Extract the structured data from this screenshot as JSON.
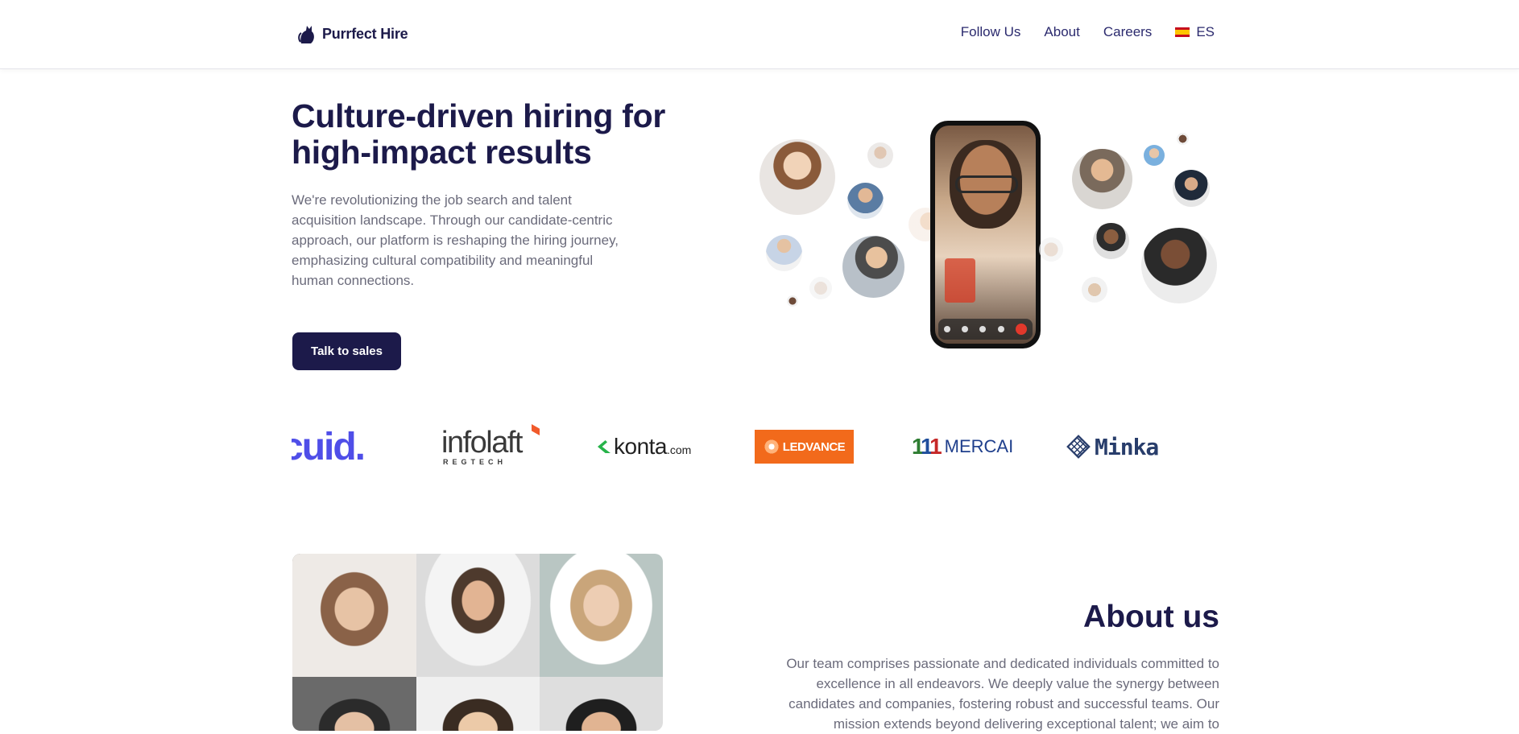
{
  "header": {
    "brand": "Purrfect Hire",
    "nav": [
      {
        "label": "Follow Us"
      },
      {
        "label": "About"
      },
      {
        "label": "Careers"
      }
    ],
    "language": {
      "label": "ES",
      "flag_icon": "spain-flag-icon"
    }
  },
  "hero": {
    "title": "Culture-driven hiring for high-impact results",
    "description": "We're revolutionizing the job search and talent acquisition landscape. Through our candidate-centric approach, our platform is reshaping the hiring journey, emphasizing cultural compatibility and meaningful human connections.",
    "cta_label": "Talk to sales"
  },
  "clients": {
    "logos": [
      {
        "name": "cuid.",
        "text": "cuid."
      },
      {
        "name": "infolaft",
        "text": "infolaft",
        "sub": "REGTECH"
      },
      {
        "name": "konta.com",
        "text": "konta",
        "suffix": ".com"
      },
      {
        "name": "LEDVANCE",
        "text": "LEDVANCE"
      },
      {
        "name": "MERCAI",
        "text": "MERCAI"
      },
      {
        "name": "Minka",
        "text": "Minka"
      }
    ]
  },
  "about": {
    "title": "About us",
    "text": "Our team comprises passionate and dedicated individuals committed to excellence in all endeavors. We deeply value the synergy between candidates and companies, fostering robust and successful teams. Our mission extends beyond delivering exceptional talent; we aim to"
  },
  "colors": {
    "primary": "#1c1a4a",
    "nav": "#2b2a6e",
    "body_text": "#6b6b7b",
    "ledvance_orange": "#f26a1b",
    "cuid_blue": "#4f4ee8"
  }
}
